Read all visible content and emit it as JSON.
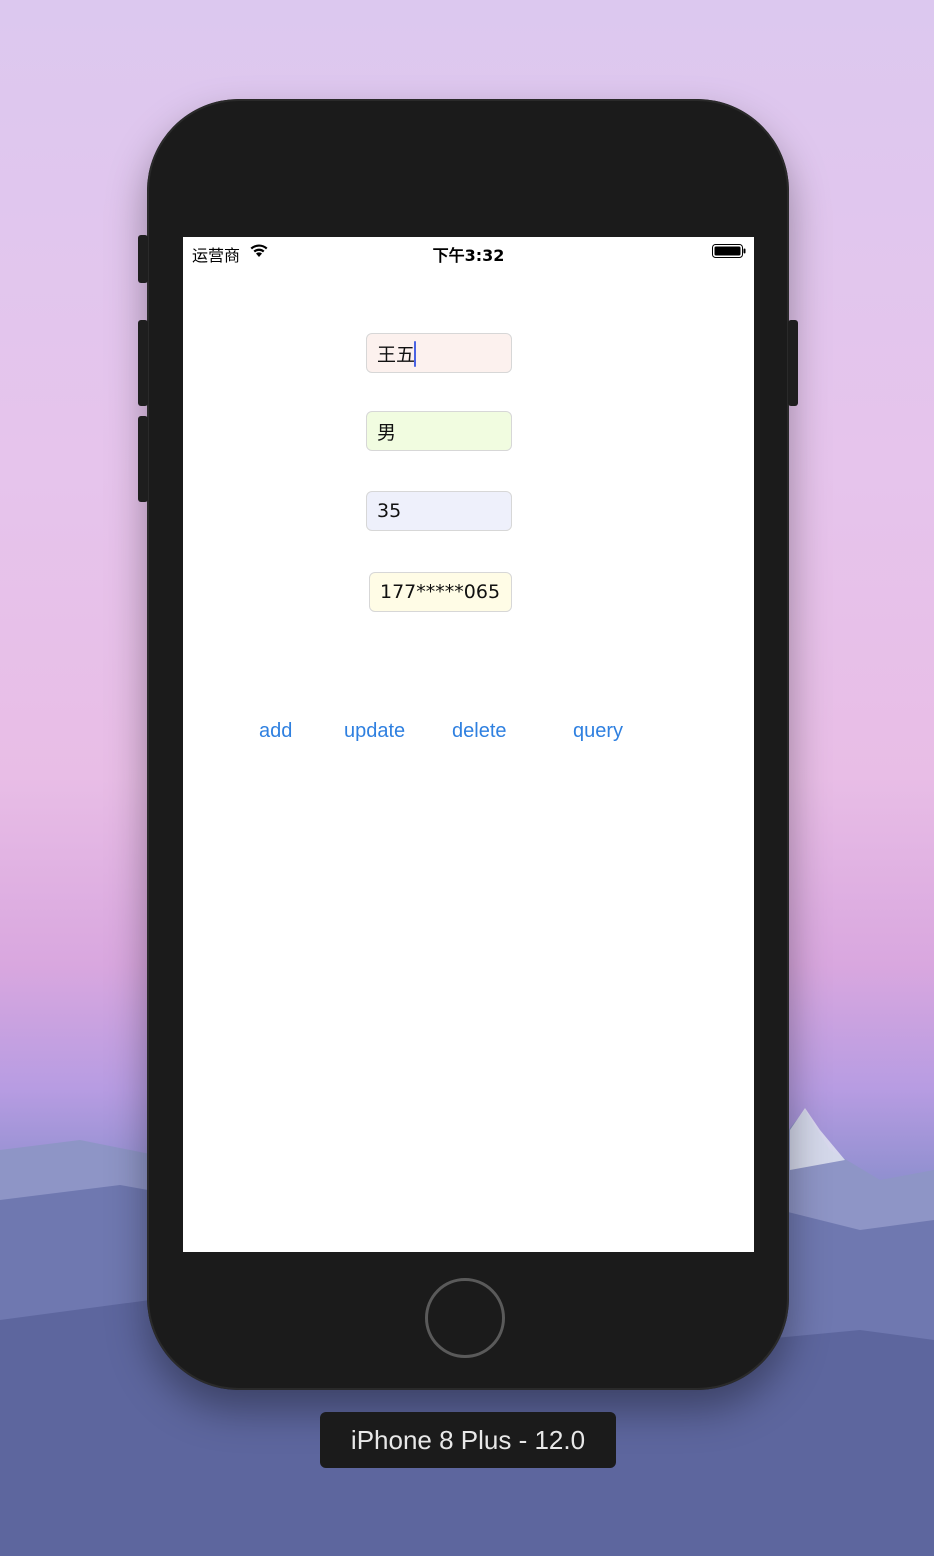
{
  "device": {
    "label": "iPhone 8 Plus - 12.0"
  },
  "status_bar": {
    "carrier": "运营商",
    "time": "下午3:32"
  },
  "form": {
    "name": {
      "value": "王五",
      "bg": "#fcf1ee"
    },
    "gender": {
      "value": "男",
      "bg": "#f1fce0"
    },
    "age": {
      "value": "35",
      "bg": "#eef0fb"
    },
    "phone": {
      "value": "177*****065",
      "bg": "#fffce6"
    }
  },
  "actions": {
    "add": "add",
    "update": "update",
    "delete": "delete",
    "query": "query"
  },
  "colors": {
    "accent": "#2f80e0",
    "cursor": "#4a63e3",
    "phone_body": "#1b1b1b"
  },
  "icons": {
    "wifi": "wifi-icon",
    "battery": "battery-icon"
  }
}
